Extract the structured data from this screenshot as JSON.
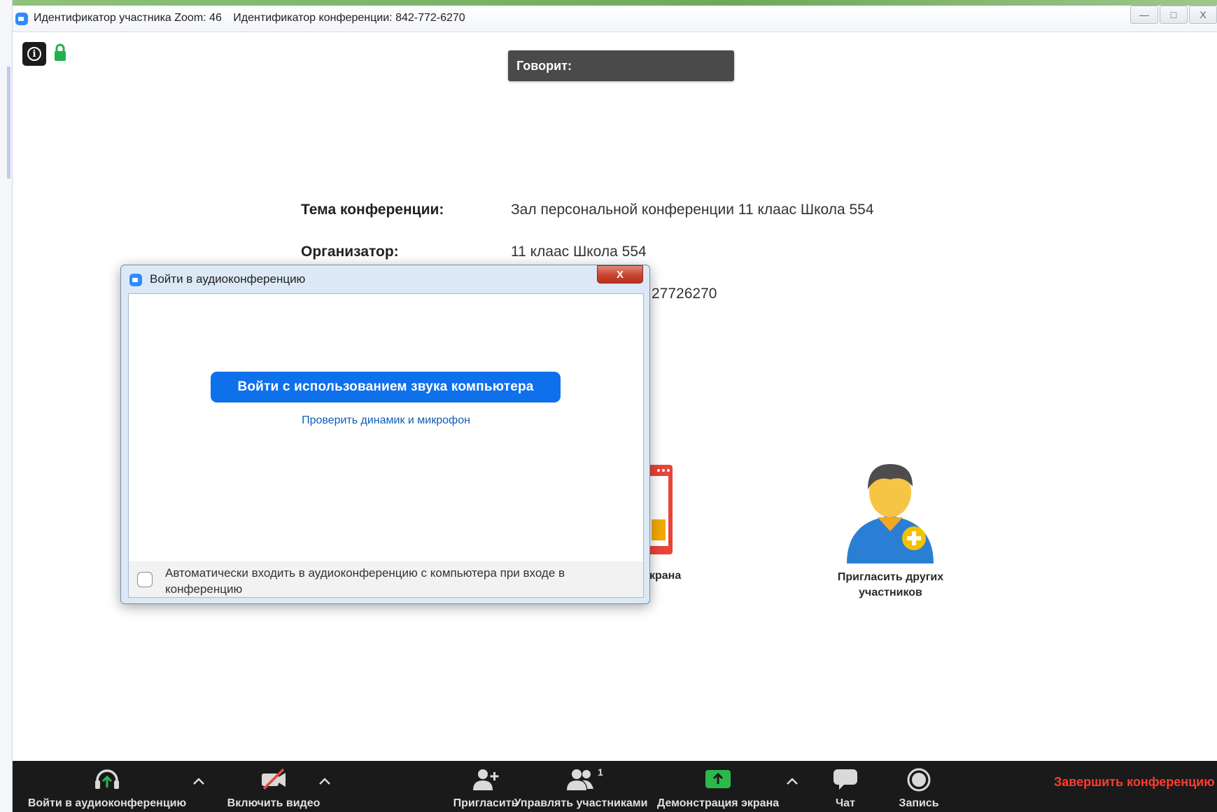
{
  "window": {
    "participant_id": "Идентификатор участника Zoom: 46",
    "conference_id": "Идентификатор конференции: 842-772-6270",
    "controls": [
      "—",
      "□",
      "X"
    ]
  },
  "speaking": {
    "label": "Говорит:"
  },
  "meeting_info": {
    "topic_label": "Тема конференции:",
    "topic_value": "Зал персональной конференции 11 клаас Школа 554",
    "host_label": "Организатор:",
    "host_value": "11 клаас Школа 554",
    "partial_value": "27726270"
  },
  "invite": {
    "label": "Пригласить других участников"
  },
  "share_partial": {
    "label": "крана"
  },
  "dialog": {
    "title": "Войти в аудиоконференцию",
    "close_label": "X",
    "primary_button": "Войти с использованием звука компьютера",
    "test_link": "Проверить динамик и микрофон",
    "auto_join_text": "Автоматически входить в аудиоконференцию с компьютера при входе в конференцию",
    "auto_join_checked": false
  },
  "toolbar": {
    "audio": "Войти в аудиоконференцию",
    "video": "Включить видео",
    "invite": "Пригласить",
    "participants": "Управлять участниками",
    "participants_count": "1",
    "share": "Демонстрация экрана",
    "chat": "Чат",
    "record": "Запись",
    "end": "Завершить конференцию"
  },
  "colors": {
    "accent": "#0e71eb",
    "share_green": "#2db84c",
    "end_red": "#ff3b30",
    "toolbar_bg": "#1a1a1a"
  }
}
